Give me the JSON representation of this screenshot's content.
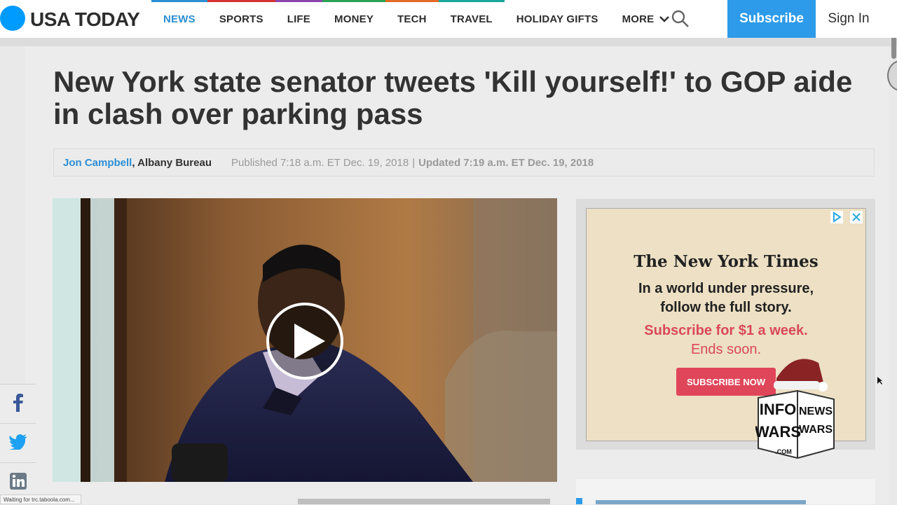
{
  "site": {
    "logo_text": "USA TODAY",
    "brand_color": "#009bff"
  },
  "nav": {
    "items": [
      {
        "label": "NEWS",
        "active": true,
        "accent": "#2b8fd3"
      },
      {
        "label": "SPORTS",
        "active": false,
        "accent": "#d63330"
      },
      {
        "label": "LIFE",
        "active": false,
        "accent": "#8e44ad"
      },
      {
        "label": "MONEY",
        "active": false,
        "accent": "#2aa253"
      },
      {
        "label": "TECH",
        "active": false,
        "accent": "#e36a25"
      },
      {
        "label": "TRAVEL",
        "active": false,
        "accent": "#19a69a"
      },
      {
        "label": "HOLIDAY GIFTS",
        "active": false,
        "accent": "#ffffff"
      },
      {
        "label": "MORE",
        "active": false,
        "accent": "#ffffff"
      }
    ],
    "more_icon": "chevron-down-icon",
    "search_icon": "search-icon",
    "subscribe_label": "Subscribe",
    "signin_label": "Sign In"
  },
  "article": {
    "headline": "New York state senator tweets 'Kill yourself!' to GOP aide in clash over parking pass",
    "author": "Jon Campbell",
    "bureau": ", Albany Bureau",
    "published": "Published 7:18 a.m. ET Dec. 19, 2018",
    "separator": "|",
    "updated": "Updated 7:19 a.m. ET Dec. 19, 2018"
  },
  "video": {
    "play_icon": "play-icon"
  },
  "ad": {
    "brand": "The New York Times",
    "line1": "In a world under pressure,",
    "line2": "follow the full story.",
    "offer": "Subscribe for $1 a week.",
    "ends": "Ends soon.",
    "cta": "SUBSCRIBE NOW",
    "accent": "#e0465a"
  },
  "watermark": {
    "lines": [
      "INFO",
      "WARS",
      "NEWS",
      "WARS",
      ".COM"
    ]
  },
  "social": {
    "facebook_icon": "facebook-icon",
    "twitter_icon": "twitter-icon",
    "linkedin_icon": "linkedin-icon"
  },
  "status": {
    "text": "Waiting for trc.taboola.com..."
  }
}
